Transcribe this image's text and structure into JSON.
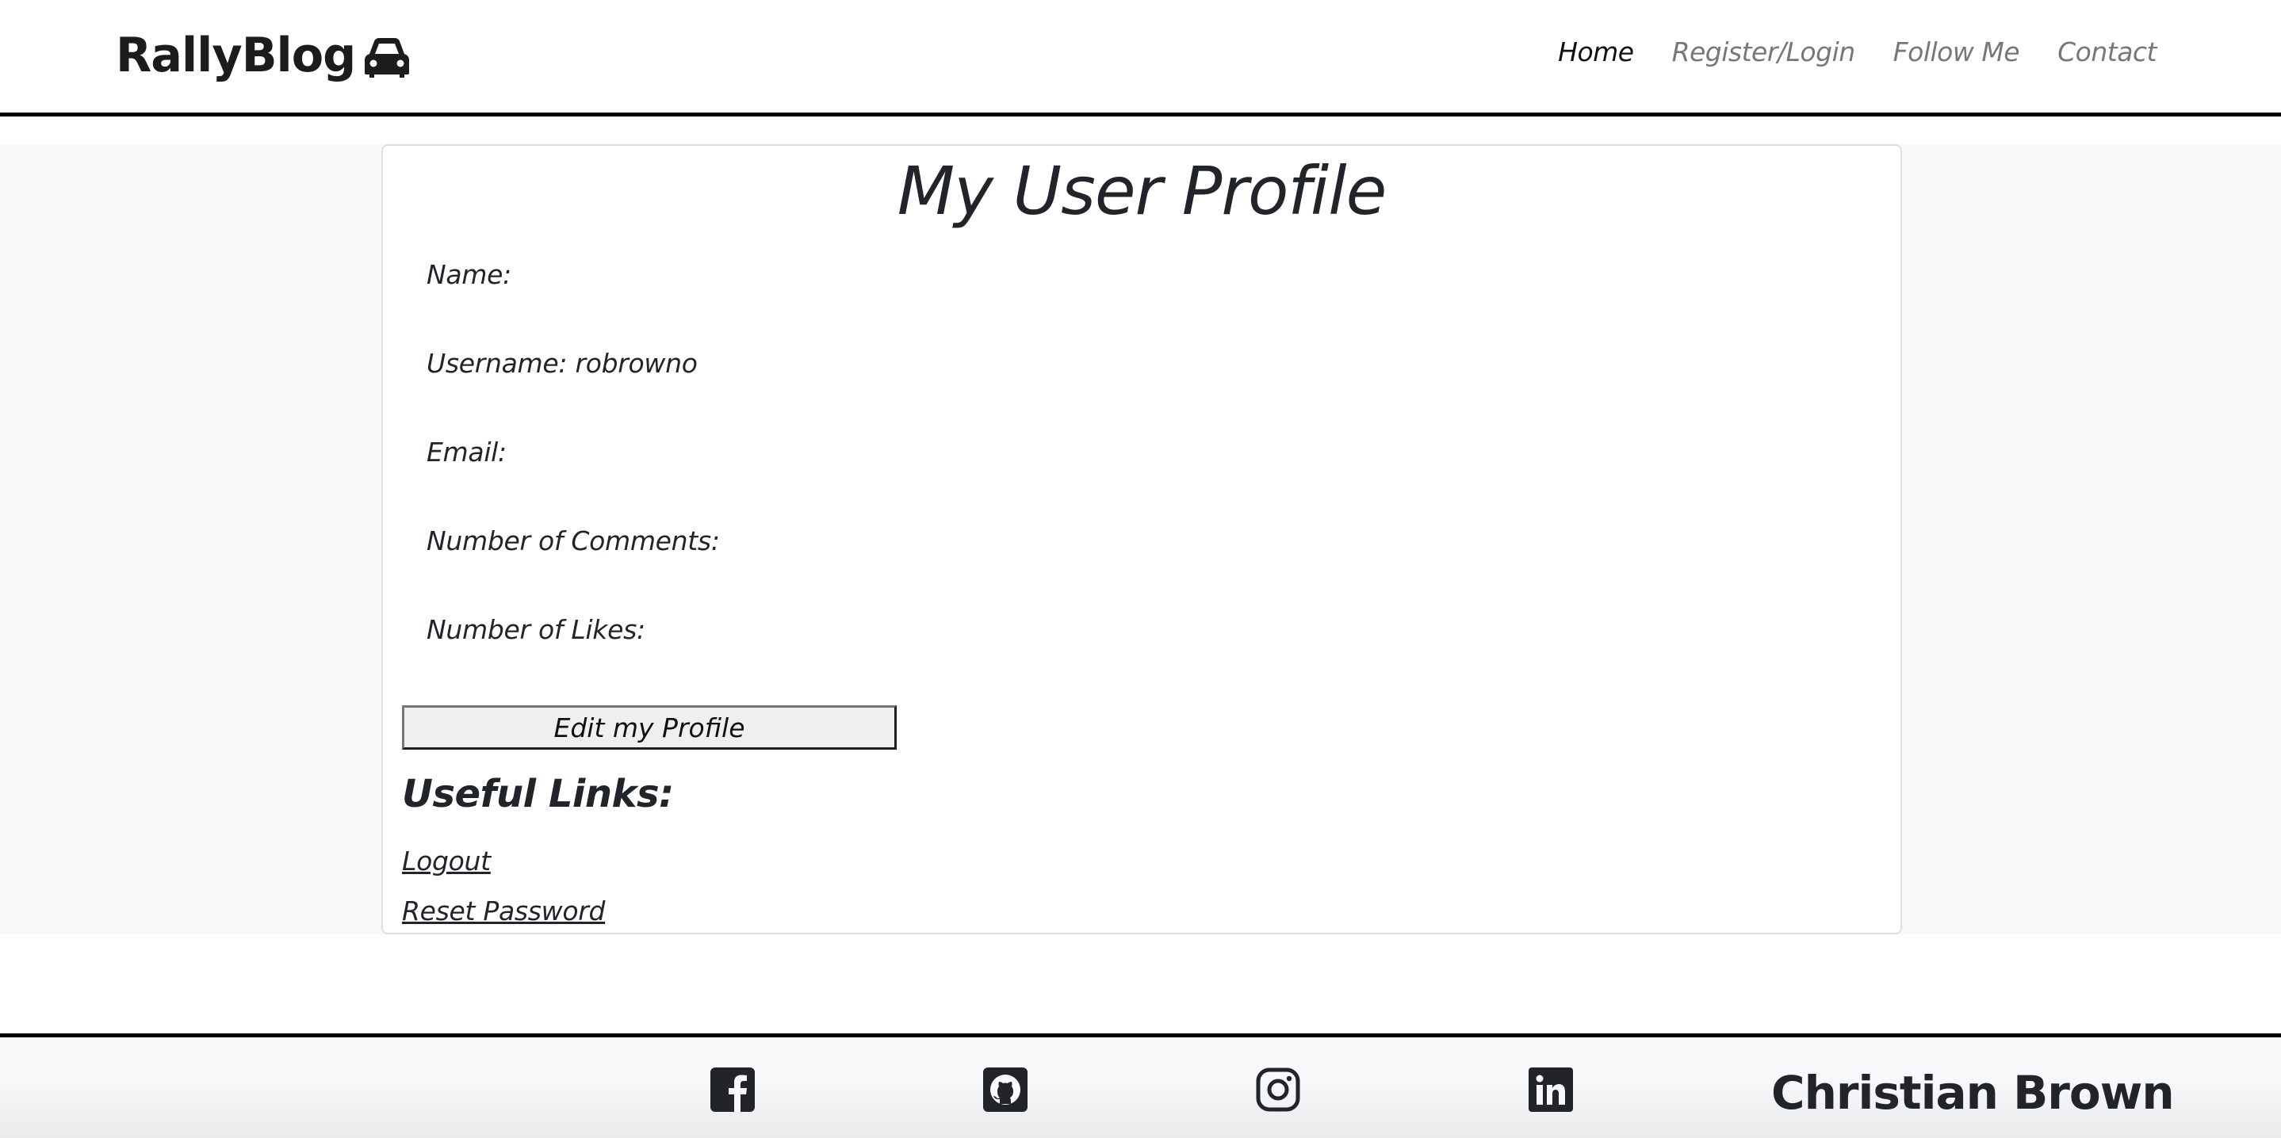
{
  "header": {
    "brand": "RallyBlog",
    "brand_icon": "car-icon",
    "nav": [
      {
        "label": "Home",
        "active": true
      },
      {
        "label": "Register/Login",
        "active": false
      },
      {
        "label": "Follow Me",
        "active": false
      },
      {
        "label": "Contact",
        "active": false
      }
    ]
  },
  "profile": {
    "title": "My User Profile",
    "fields": [
      {
        "label": "Name:",
        "value": ""
      },
      {
        "label": "Username:",
        "value": "robrowno"
      },
      {
        "label": "Email:",
        "value": ""
      },
      {
        "label": "Number of Comments:",
        "value": ""
      },
      {
        "label": "Number of Likes:",
        "value": ""
      }
    ],
    "edit_button": "Edit my Profile",
    "useful_links_heading": "Useful Links:",
    "links": [
      {
        "label": "Logout"
      },
      {
        "label": "Reset Password"
      }
    ]
  },
  "footer": {
    "social_icons": [
      "facebook-icon",
      "github-icon",
      "instagram-icon",
      "linkedin-icon"
    ],
    "author": "Christian Brown"
  },
  "colors": {
    "text": "#212529",
    "nav_inactive": "#777777",
    "band_bg": "#f8f9fa",
    "border": "#000000"
  }
}
